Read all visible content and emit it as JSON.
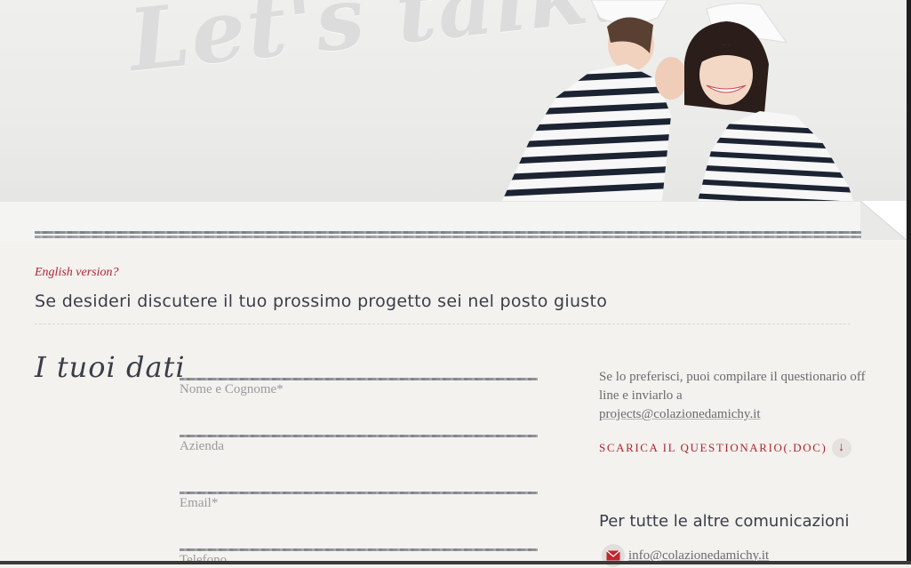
{
  "hero": {
    "script_text": "Let's talk!"
  },
  "intro": {
    "english_link": "English version?",
    "subtitle": "Se desideri discutere il tuo prossimo progetto sei nel posto giusto"
  },
  "form": {
    "section_title": "I tuoi dati",
    "fields": [
      {
        "label": "Nome e Cognome*"
      },
      {
        "label": "Azienda"
      },
      {
        "label": "Email*"
      },
      {
        "label": "Telefono"
      }
    ]
  },
  "aside": {
    "text": "Se lo preferisci, puoi compilare il questionario off line e inviarlo a",
    "email": "projects@colazionedamichy.it",
    "download_label": "SCARICA IL QUESTIONARIO(.DOC)",
    "download_icon": "arrow-down-icon",
    "other_title": "Per tutte le altre comunicazioni",
    "contact_email": "info@colazionedamichy.it",
    "contact_icon": "envelope-icon"
  },
  "colors": {
    "accent": "#b0252c",
    "heading": "#3b3e48",
    "background": "#f3f2ef"
  }
}
